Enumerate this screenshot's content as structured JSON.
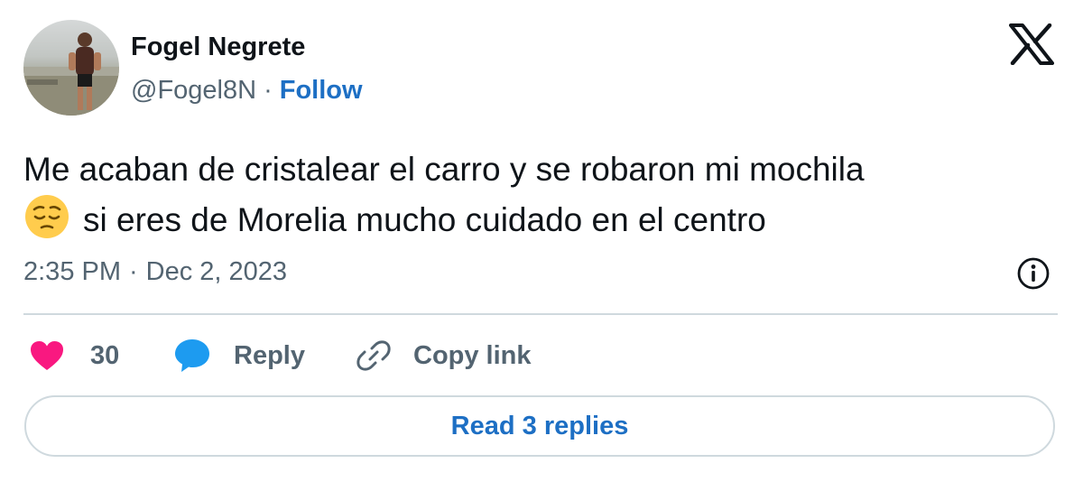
{
  "author": {
    "display_name": "Fogel Negrete",
    "handle": "@Fogel8N",
    "separator": "·",
    "follow_label": "Follow"
  },
  "tweet": {
    "text_line1": "Me acaban de cristalear el carro y se robaron mi mochila",
    "emoji": "pensive-face",
    "text_line2": "si eres de Morelia mucho cuidado en el centro",
    "time": "2:35 PM",
    "separator": "·",
    "date": "Dec 2, 2023"
  },
  "actions": {
    "like_count": "30",
    "reply_label": "Reply",
    "copy_link_label": "Copy link"
  },
  "read_replies_label": "Read 3 replies",
  "icons": {
    "brand": "x-logo-icon",
    "info": "info-icon",
    "like": "heart-icon",
    "reply": "reply-bubble-icon",
    "copy": "link-icon"
  },
  "colors": {
    "text_primary": "#0f1419",
    "text_secondary": "#536471",
    "link_blue": "#1d6fc4",
    "like_pink": "#f91880",
    "reply_blue": "#1d9bf0",
    "divider": "#cfd9de"
  }
}
